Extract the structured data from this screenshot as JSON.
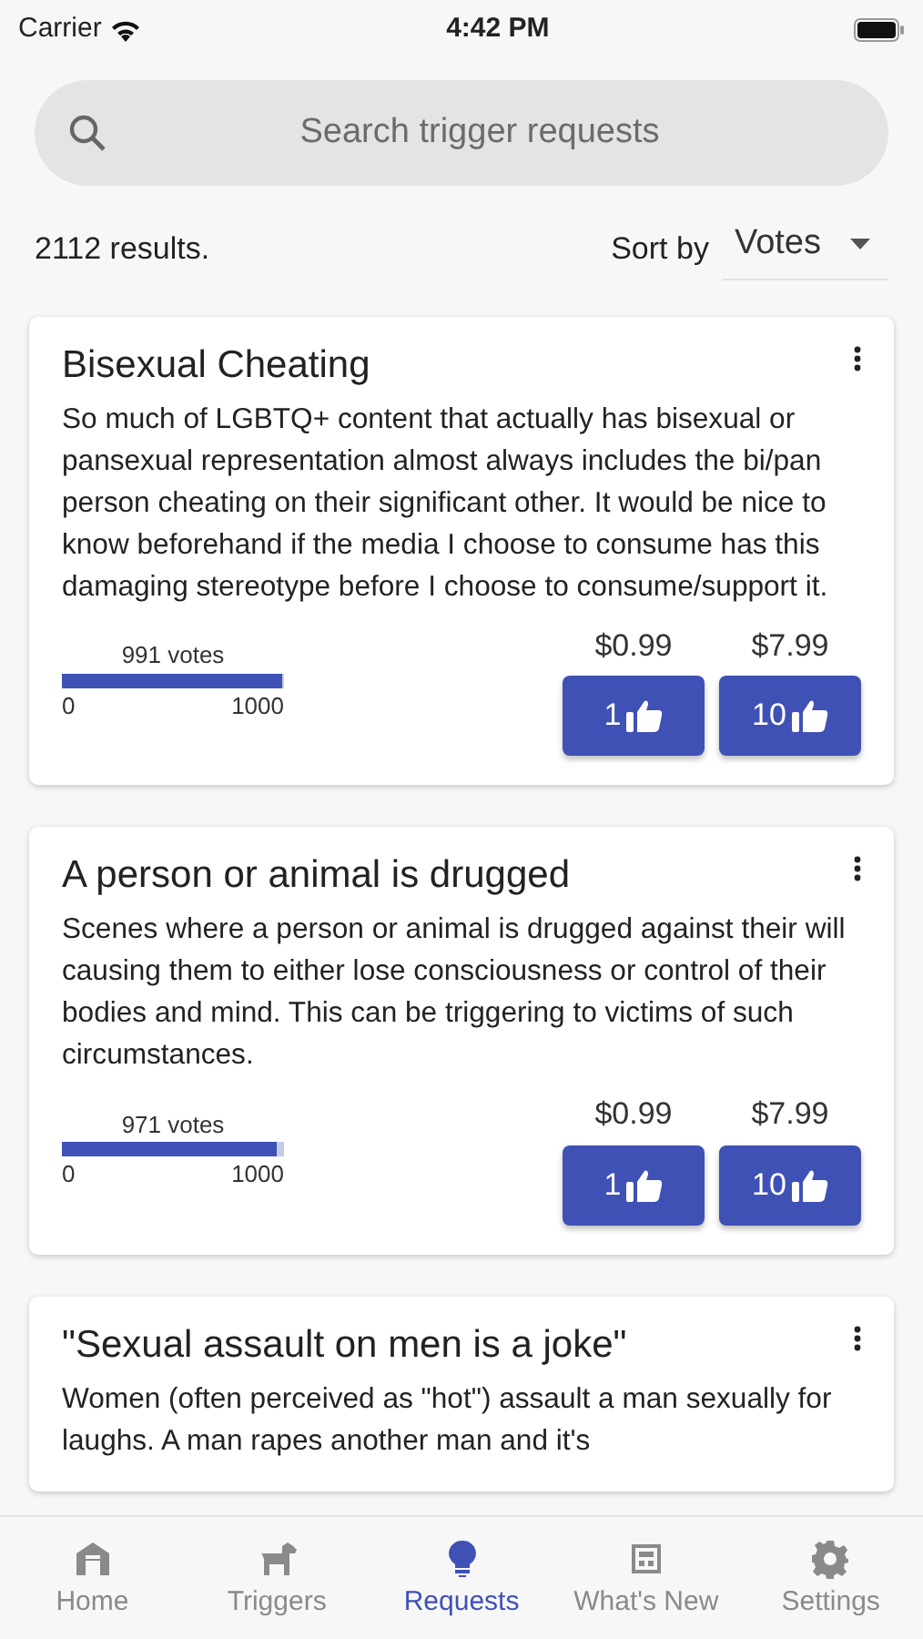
{
  "status_bar": {
    "carrier": "Carrier",
    "time": "4:42 PM"
  },
  "search": {
    "placeholder": "Search trigger requests"
  },
  "results": "2112 results.",
  "sort": {
    "label": "Sort by",
    "value": "Votes"
  },
  "requests": [
    {
      "title": "Bisexual Cheating",
      "description": "So much of LGBTQ+ content that actually has bisexual or pansexual representation almost always includes the bi/pan person cheating on their significant other. It would be nice to know beforehand if the media I choose to consume has this damaging stereotype before I choose to consume/support it.",
      "votes": "991 votes",
      "level": 0.991,
      "min": "0",
      "max": "1000",
      "options": [
        {
          "price": "$0.99",
          "count": "1"
        },
        {
          "price": "$7.99",
          "count": "10"
        }
      ]
    },
    {
      "title": "A person or animal is drugged",
      "description": "Scenes where a person or animal is drugged against their will causing them to either lose consciousness or control of their bodies and mind. This can be triggering to victims of such circumstances.",
      "votes": "971 votes",
      "level": 0.971,
      "min": "0",
      "max": "1000",
      "options": [
        {
          "price": "$0.99",
          "count": "1"
        },
        {
          "price": "$7.99",
          "count": "10"
        }
      ]
    },
    {
      "title": "\"Sexual assault on men is a joke\"",
      "description": "Women (often perceived as \"hot\") assault a man sexually for laughs. A man rapes another man and it's"
    }
  ],
  "tabs": [
    {
      "label": "Home",
      "selected": false
    },
    {
      "label": "Triggers",
      "selected": false
    },
    {
      "label": "Requests",
      "selected": true
    },
    {
      "label": "What's New",
      "selected": false
    },
    {
      "label": "Settings",
      "selected": false
    }
  ]
}
